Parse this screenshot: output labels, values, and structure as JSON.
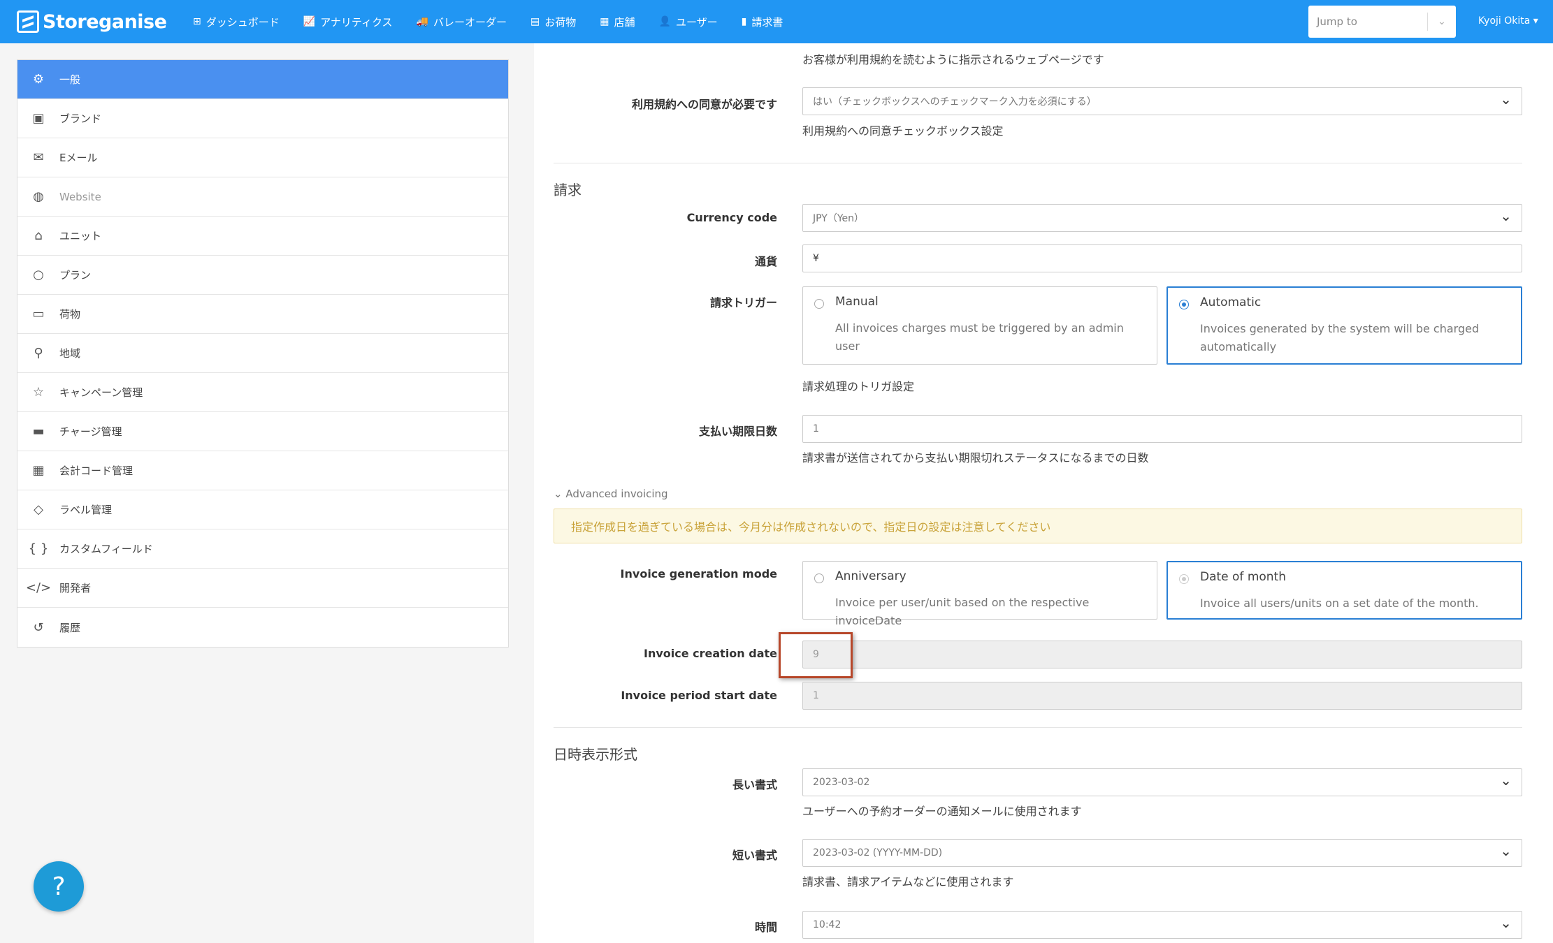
{
  "navbar": {
    "brand": "Storeganise",
    "items": [
      {
        "icon": "sitemap-icon",
        "label": "ダッシュボード"
      },
      {
        "icon": "chart-icon",
        "label": "アナリティクス"
      },
      {
        "icon": "truck-icon",
        "label": "バレーオーダー"
      },
      {
        "icon": "box-icon",
        "label": "お荷物"
      },
      {
        "icon": "building-icon",
        "label": "店舗"
      },
      {
        "icon": "user-icon",
        "label": "ユーザー"
      },
      {
        "icon": "file-icon",
        "label": "請求書"
      }
    ],
    "jump_placeholder": "Jump to",
    "user": "Kyoji Okita"
  },
  "sidebar": {
    "items": [
      {
        "icon": "gear-icon",
        "label": "一般"
      },
      {
        "icon": "image-icon",
        "label": "ブランド"
      },
      {
        "icon": "envelope-icon",
        "label": "Eメール"
      },
      {
        "icon": "globe-icon",
        "label": "Website"
      },
      {
        "icon": "warehouse-icon",
        "label": "ユニット"
      },
      {
        "icon": "circle-icon",
        "label": "プラン"
      },
      {
        "icon": "archive-icon",
        "label": "荷物"
      },
      {
        "icon": "map-pin-icon",
        "label": "地域"
      },
      {
        "icon": "star-icon",
        "label": "キャンペーン管理"
      },
      {
        "icon": "money-icon",
        "label": "チャージ管理"
      },
      {
        "icon": "calculator-icon",
        "label": "会計コード管理"
      },
      {
        "icon": "tags-icon",
        "label": "ラベル管理"
      },
      {
        "icon": "braces-icon",
        "label": "カスタムフィールド"
      },
      {
        "icon": "code-icon",
        "label": "開発者"
      },
      {
        "icon": "history-icon",
        "label": "履歴"
      }
    ]
  },
  "terms": {
    "url_help": "お客様が利用規約を読むように指示されるウェブページです",
    "agree_label": "利用規約への同意が必要です",
    "agree_value": "はい（チェックボックスへのチェックマーク入力を必須にする）",
    "agree_help": "利用規約への同意チェックボックス設定"
  },
  "billing": {
    "title": "請求",
    "currency_code_label": "Currency code",
    "currency_code_value": "JPY（Yen）",
    "currency_label": "通貨",
    "currency_value": "¥",
    "trigger_label": "請求トリガー",
    "trigger_manual_title": "Manual",
    "trigger_manual_desc": "All invoices charges must be triggered by an admin user",
    "trigger_auto_title": "Automatic",
    "trigger_auto_desc": "Invoices generated by the system will be charged automatically",
    "trigger_help": "請求処理のトリガ設定",
    "due_days_label": "支払い期限日数",
    "due_days_value": "1",
    "due_days_help": "請求書が送信されてから支払い期限切れステータスになるまでの日数",
    "advanced_toggle": "Advanced invoicing",
    "warning": "指定作成日を過ぎている場合は、今月分は作成されないので、指定日の設定は注意してください",
    "mode_label": "Invoice generation mode",
    "mode_anniv_title": "Anniversary",
    "mode_anniv_desc": "Invoice per user/unit based on the respective invoiceDate",
    "mode_month_title": "Date of month",
    "mode_month_desc": "Invoice all users/units on a set date of the month.",
    "creation_date_label": "Invoice creation date",
    "creation_date_value": "9",
    "period_start_label": "Invoice period start date",
    "period_start_value": "1"
  },
  "datetime": {
    "title": "日時表示形式",
    "long_label": "長い書式",
    "long_value": "2023-03-02",
    "long_help": "ユーザーへの予約オーダーの通知メールに使用されます",
    "short_label": "短い書式",
    "short_value": "2023-03-02 (YYYY-MM-DD)",
    "short_help": "請求書、請求アイテムなどに使用されます",
    "time_label": "時間",
    "time_value": "10:42"
  },
  "help_button": "?"
}
